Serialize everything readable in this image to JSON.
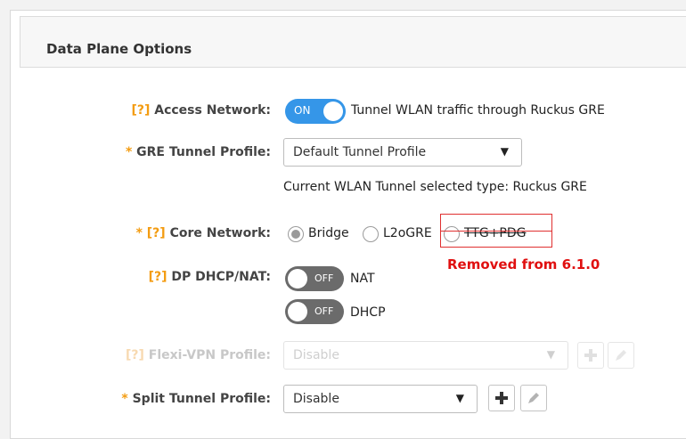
{
  "panel": {
    "title": "Data Plane Options"
  },
  "access_network": {
    "help": "[?]",
    "label": "Access Network:",
    "toggle_label": "ON",
    "toggle_state": "on",
    "description": "Tunnel WLAN traffic through Ruckus GRE"
  },
  "gre_tunnel_profile": {
    "required_mark": "*",
    "label": "GRE Tunnel Profile:",
    "value": "Default Tunnel Profile",
    "info": "Current WLAN Tunnel selected type: Ruckus GRE"
  },
  "core_network": {
    "required_mark": "*",
    "help": "[?]",
    "label": "Core Network:",
    "options": [
      {
        "label": "Bridge",
        "selected": true
      },
      {
        "label": "L2oGRE",
        "selected": false
      },
      {
        "label": "TTG+PDG",
        "selected": false
      }
    ],
    "annotation": "Removed from 6.1.0",
    "annotation_color": "#e01010"
  },
  "dp_dhcp_nat": {
    "help": "[?]",
    "label": "DP DHCP/NAT:",
    "toggles": [
      {
        "toggle_label": "OFF",
        "state": "off",
        "name": "NAT"
      },
      {
        "toggle_label": "OFF",
        "state": "off",
        "name": "DHCP"
      }
    ]
  },
  "flexi_vpn_profile": {
    "help": "[?]",
    "label": "Flexi-VPN Profile:",
    "value": "Disable",
    "disabled": true
  },
  "split_tunnel_profile": {
    "required_mark": "*",
    "label": "Split Tunnel Profile:",
    "value": "Disable"
  },
  "colors": {
    "accent": "#3596e8",
    "help": "#f39c12",
    "toggle_off": "#6b6b6b"
  },
  "icons": {
    "add": "plus-icon",
    "edit": "pencil-icon",
    "dropdown": "caret-down-icon"
  }
}
